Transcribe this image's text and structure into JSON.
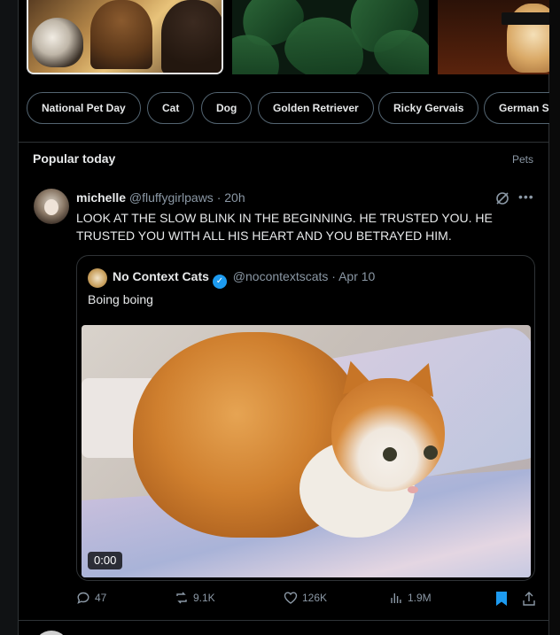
{
  "trending_chips": [
    "National Pet Day",
    "Cat",
    "Dog",
    "Golden Retriever",
    "Ricky Gervais",
    "German S"
  ],
  "section": {
    "title": "Popular today",
    "category": "Pets"
  },
  "tweet": {
    "display_name": "michelle",
    "handle": "@fluffygirlpaws",
    "time": "· 20h",
    "text": "LOOK AT THE SLOW BLINK IN THE BEGINNING. HE TRUSTED YOU. HE TRUSTED YOU WITH ALL HIS HEART AND YOU BETRAYED HIM.",
    "quoted": {
      "display_name": "No Context Cats",
      "verified": true,
      "handle": "@nocontextscats",
      "time": "· Apr 10",
      "text": "Boing boing",
      "video_time": "0:00"
    },
    "stats": {
      "replies": "47",
      "reposts": "9.1K",
      "likes": "126K",
      "views": "1.9M"
    },
    "bookmarked": true
  },
  "colors": {
    "accent": "#1d9bf0",
    "muted": "#8b98a5",
    "border": "#2f3336"
  }
}
